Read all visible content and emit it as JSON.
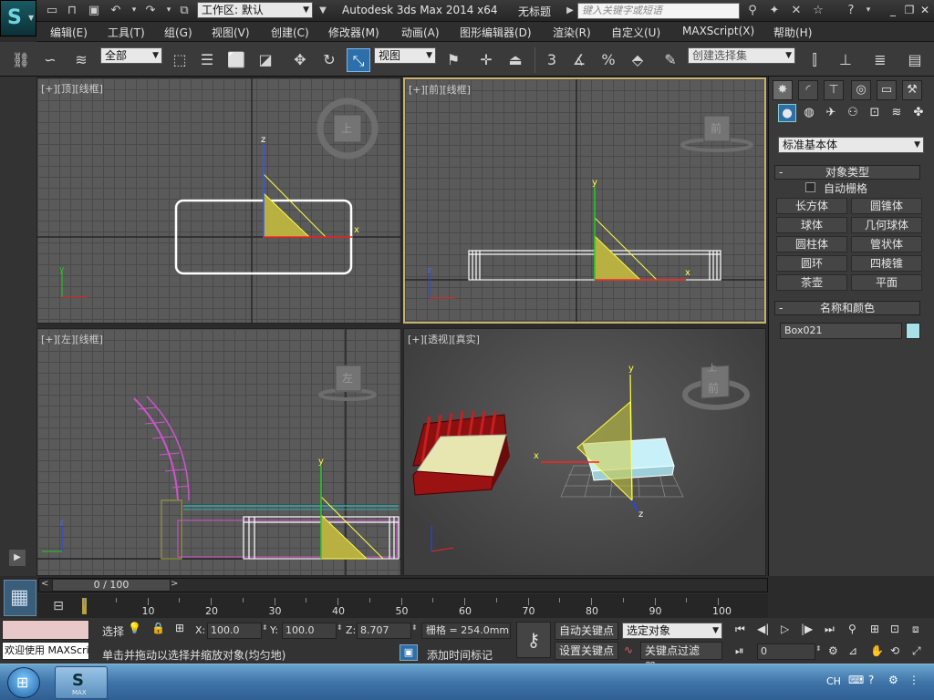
{
  "titlebar": {
    "workspace_label": "工作区: 默认",
    "app_title": "Autodesk 3ds Max  2014 x64",
    "doc_title": "无标题",
    "search_placeholder": "键入关键字或短语"
  },
  "menubar": [
    "编辑(E)",
    "工具(T)",
    "组(G)",
    "视图(V)",
    "创建(C)",
    "修改器(M)",
    "动画(A)",
    "图形编辑器(D)",
    "渲染(R)",
    "自定义(U)",
    "MAXScript(X)",
    "帮助(H)"
  ],
  "toolbar": {
    "selection_filter": "全部",
    "ref_coord": "视图",
    "snap_toggle": "3",
    "angle_snap": "%",
    "named_selection_placeholder": "创建选择集"
  },
  "viewports": {
    "top": {
      "label": "[+][顶][线框]",
      "cube_face": "上"
    },
    "front": {
      "label": "[+][前][线框]",
      "cube_face": "前"
    },
    "left": {
      "label": "[+][左][线框]",
      "cube_face": "左"
    },
    "persp": {
      "label": "[+][透视][真实]",
      "cube_face": "前",
      "cube_top": "上"
    }
  },
  "axis": {
    "x": "x",
    "y": "y",
    "z": "z"
  },
  "command_panel": {
    "category": "标准基本体",
    "object_type_title": "对象类型",
    "autogrid_label": "自动栅格",
    "object_buttons": [
      "长方体",
      "圆锥体",
      "球体",
      "几何球体",
      "圆柱体",
      "管状体",
      "圆环",
      "四棱锥",
      "茶壶",
      "平面"
    ],
    "name_color_title": "名称和颜色",
    "object_name": "Box021",
    "object_color": "#a8e0e8",
    "rollout_minus": "-"
  },
  "timeline": {
    "frame_display": "0 / 100",
    "ticks": [
      "10",
      "20",
      "30",
      "40",
      "50",
      "60",
      "70",
      "80",
      "90",
      "100"
    ]
  },
  "status": {
    "maxscript_label": "欢迎使用 MAXScri",
    "selection_text": "选择",
    "prompt_text": "单击并拖动以选择并缩放对象(均匀地)",
    "x_label": "X:",
    "x_value": "100.0",
    "y_label": "Y:",
    "y_value": "100.0",
    "z_label": "Z:",
    "z_value": "8.707",
    "grid_label": "栅格 = 254.0mm",
    "add_time_tag": "添加时间标记",
    "auto_key": "自动关键点",
    "set_key": "设置关键点",
    "key_mode_select": "选定对象",
    "key_filters": "关键点过滤器...",
    "current_frame": "0"
  },
  "taskbar": {
    "lang": "CH",
    "app_label": "MAX"
  }
}
